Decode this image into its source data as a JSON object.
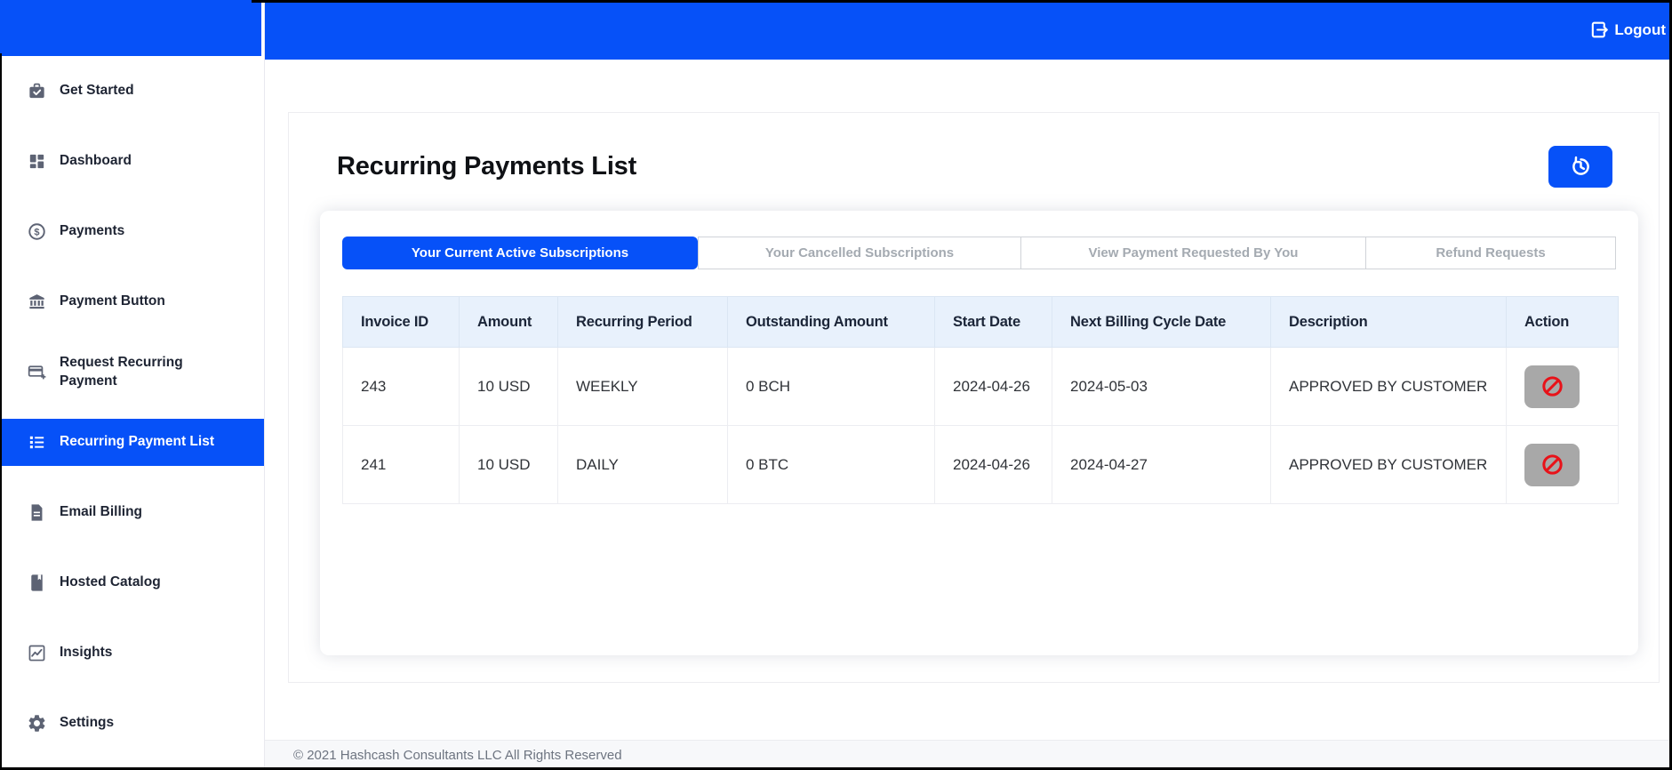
{
  "colors": {
    "accent": "#0651f8",
    "table_header_bg": "#e8f1fc",
    "danger": "#e81219",
    "action_button_bg": "#a8a8a8"
  },
  "topbar": {
    "logout_label": "Logout"
  },
  "sidebar": {
    "items": [
      {
        "label": "Get Started"
      },
      {
        "label": "Dashboard"
      },
      {
        "label": "Payments"
      },
      {
        "label": "Payment Button"
      },
      {
        "label": "Request Recurring Payment"
      },
      {
        "label": "Recurring Payment List",
        "active": true
      },
      {
        "label": "Email Billing"
      },
      {
        "label": "Hosted Catalog"
      },
      {
        "label": "Insights"
      },
      {
        "label": "Settings"
      }
    ]
  },
  "main": {
    "title": "Recurring Payments List",
    "tabs": [
      {
        "label": "Your Current Active Subscriptions",
        "active": true
      },
      {
        "label": "Your Cancelled Subscriptions",
        "active": false
      },
      {
        "label": "View Payment Requested By You",
        "active": false
      },
      {
        "label": "Refund Requests",
        "active": false
      }
    ],
    "table": {
      "columns": [
        "Invoice ID",
        "Amount",
        "Recurring Period",
        "Outstanding Amount",
        "Start Date",
        "Next Billing Cycle Date",
        "Description",
        "Action"
      ],
      "rows": [
        {
          "invoice_id": "243",
          "amount": "10 USD",
          "recurring_period": "WEEKLY",
          "outstanding_amount": "0 BCH",
          "start_date": "2024-04-26",
          "next_billing_cycle_date": "2024-05-03",
          "description": "APPROVED BY CUSTOMER"
        },
        {
          "invoice_id": "241",
          "amount": "10 USD",
          "recurring_period": "DAILY",
          "outstanding_amount": "0 BTC",
          "start_date": "2024-04-26",
          "next_billing_cycle_date": "2024-04-27",
          "description": "APPROVED BY CUSTOMER"
        }
      ]
    }
  },
  "footer": {
    "copyright": "© 2021 Hashcash Consultants LLC All Rights Reserved"
  }
}
